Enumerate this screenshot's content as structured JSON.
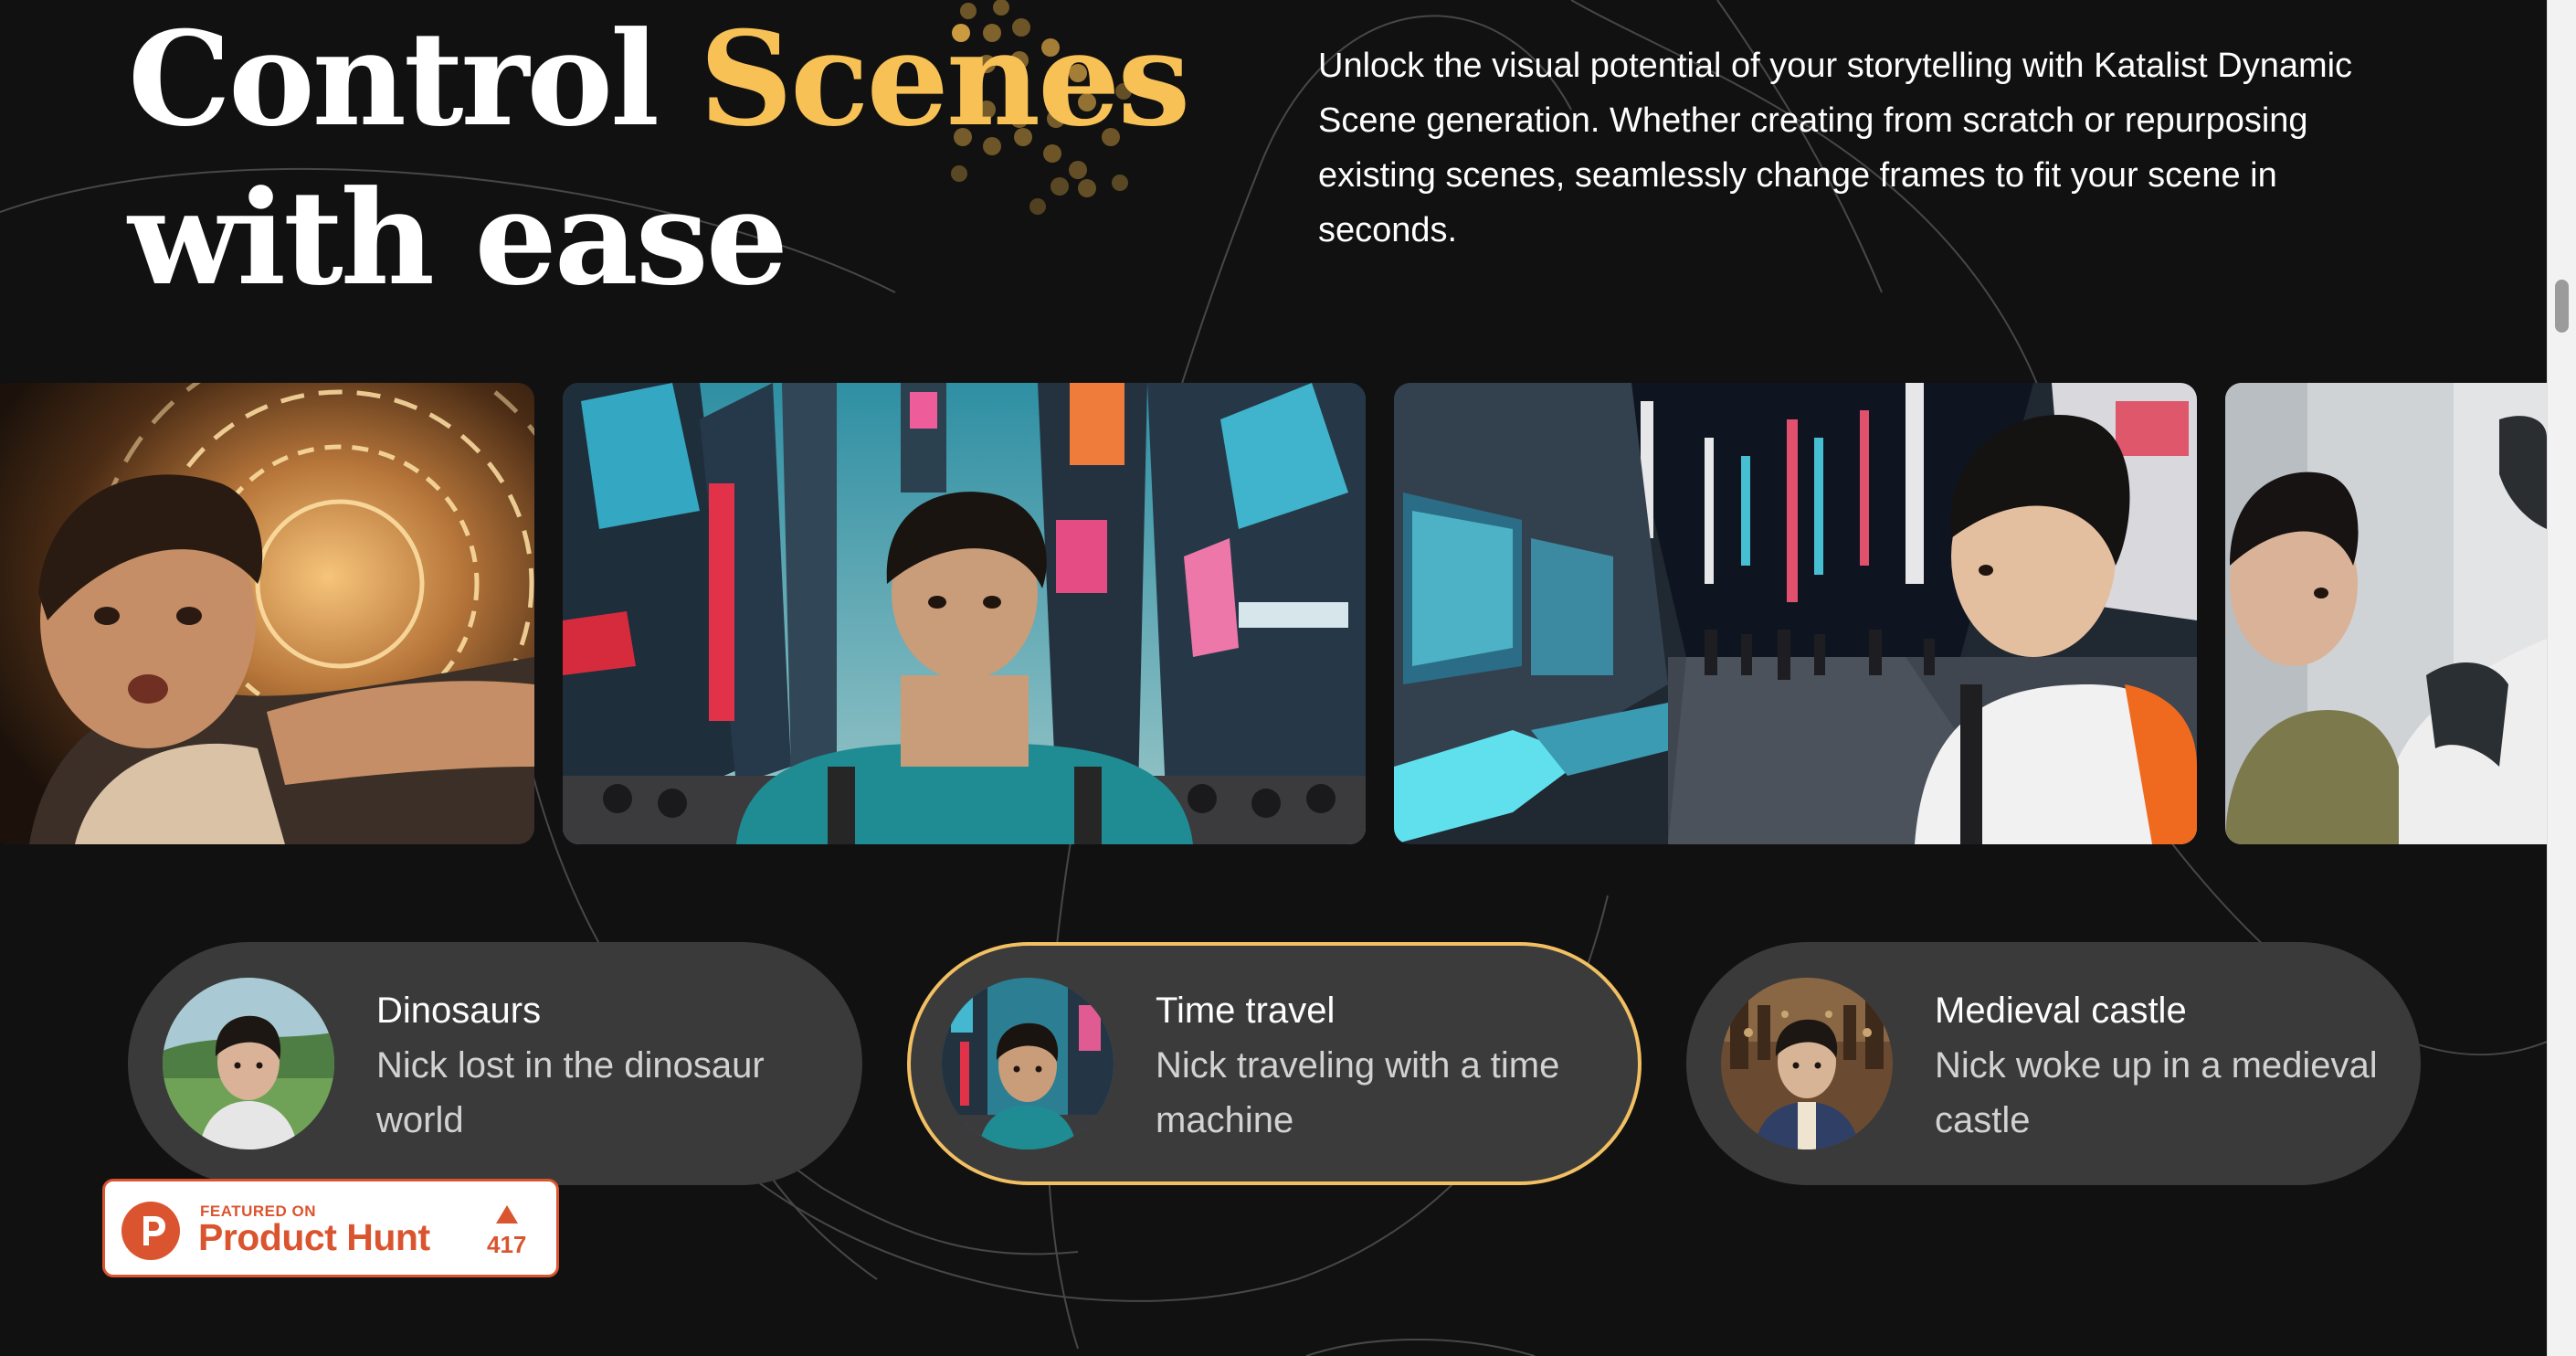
{
  "hero": {
    "headline_line1_a": "Control ",
    "headline_line1_b": "Scenes",
    "headline_line2": "with ease",
    "description": "Unlock the visual potential of your storytelling with Katalist Dynamic Scene generation. Whether creating from scratch or repurposing existing scenes, seamlessly change frames to fit your scene in seconds."
  },
  "gallery": {
    "frames": [
      {
        "icon": "boy-with-time-portal-image"
      },
      {
        "icon": "boy-in-city-street-image"
      },
      {
        "icon": "boy-beside-futuristic-screens-image"
      },
      {
        "icon": "boy-with-robot-image"
      }
    ]
  },
  "scenes": [
    {
      "title": "Dinosaurs",
      "desc": "Nick lost in the dinosaur world",
      "icon": "dinosaur-scene-thumbnail",
      "active": false
    },
    {
      "title": "Time travel",
      "desc": "Nick traveling with a time machine",
      "icon": "time-travel-scene-thumbnail",
      "active": true
    },
    {
      "title": "Medieval castle",
      "desc": "Nick woke up in a medieval castle",
      "icon": "medieval-castle-scene-thumbnail",
      "active": false
    }
  ],
  "product_hunt": {
    "featured": "FEATURED ON",
    "name": "Product Hunt",
    "count": "417"
  },
  "colors": {
    "background": "#111111",
    "accent": "#f7c156",
    "active_border": "#f2c062",
    "card": "#3a3a3a",
    "product_hunt": "#da552f"
  }
}
